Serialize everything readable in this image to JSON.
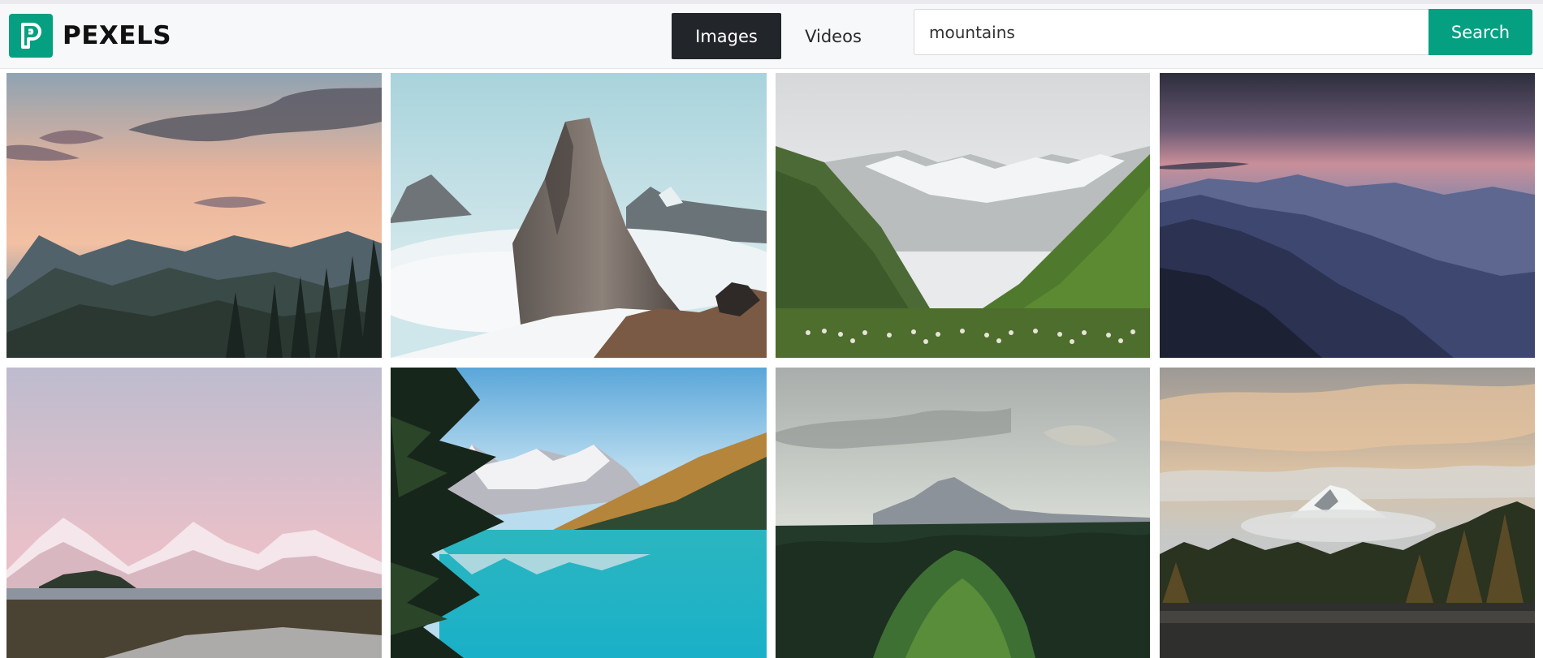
{
  "brand": {
    "name": "PEXELS",
    "color": "#05a081"
  },
  "tabs": [
    {
      "label": "Images",
      "active": true
    },
    {
      "label": "Videos",
      "active": false
    }
  ],
  "search": {
    "value": "mountains",
    "button_label": "Search"
  },
  "icons": {
    "logo": "pexels-logo-icon"
  }
}
